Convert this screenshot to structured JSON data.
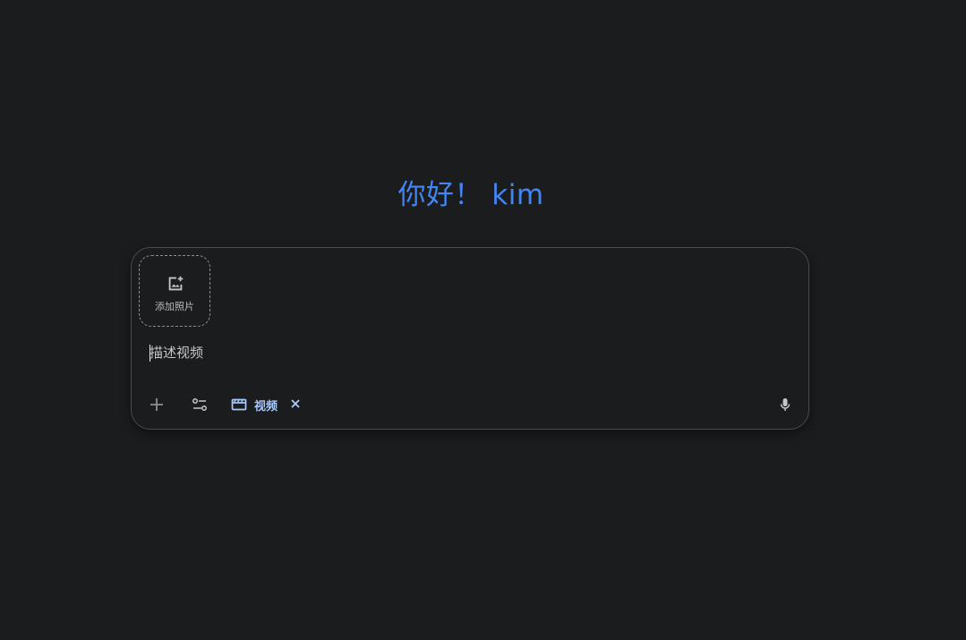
{
  "greeting": {
    "text": "你好！ kim"
  },
  "composer": {
    "add_photo_label": "添加照片",
    "prompt_placeholder": "描述视频",
    "prompt_value": "",
    "chip_label": "视频",
    "icons": {
      "add_photo": "add-photo-icon",
      "plus": "plus-icon",
      "settings": "tune-sliders-icon",
      "chip": "movie-clapper-icon",
      "chip_close": "close-icon",
      "mic": "microphone-icon"
    }
  },
  "colors": {
    "background": "#1b1c1e",
    "accent": "#4285f4",
    "chip": "#a8c7fa"
  }
}
